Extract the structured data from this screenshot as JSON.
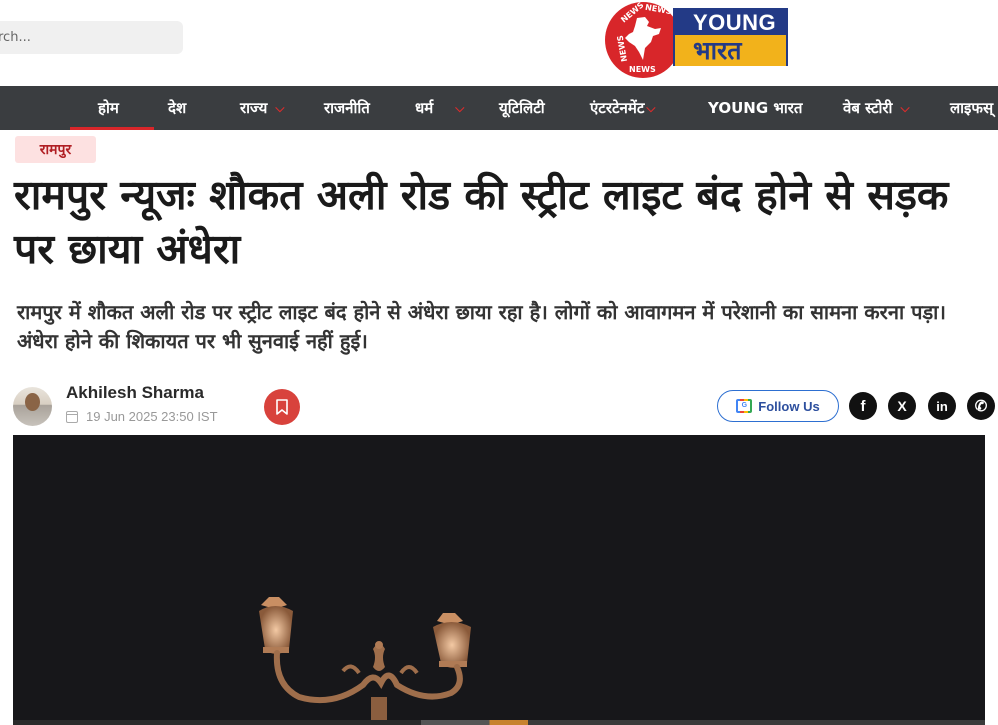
{
  "header": {
    "search_placeholder": "rch...",
    "logo": {
      "young": "YOUNG",
      "bharat": "भारत",
      "ring_text": "NEWS"
    }
  },
  "nav": {
    "items": [
      {
        "label": "होम",
        "has_dropdown": false,
        "active": true
      },
      {
        "label": "देश",
        "has_dropdown": false
      },
      {
        "label": "राज्य",
        "has_dropdown": true
      },
      {
        "label": "राजनीति",
        "has_dropdown": false
      },
      {
        "label": "धर्म",
        "has_dropdown": true
      },
      {
        "label": "यूटिलिटी",
        "has_dropdown": false
      },
      {
        "label": "एंटरटेनमेंट",
        "has_dropdown": true
      },
      {
        "label": "YOUNG भारत",
        "has_dropdown": false
      },
      {
        "label": "वेब स्टोरी",
        "has_dropdown": true
      },
      {
        "label": "लाइफस्",
        "has_dropdown": false
      }
    ]
  },
  "article": {
    "category": "रामपुर",
    "headline": "रामपुर न्यूजः शौकत अली रोड की स्ट्रीट लाइट बंद होने से सड़क पर छाया अंधेरा",
    "summary": "रामपुर में शौकत अली रोड पर स्ट्रीट लाइट बंद होने से अंधेरा छाया रहा है। लोगों को आवागमन में परेशानी का सामना करना पड़ा। अंधेरा होने की शिकायत पर भी सुनवाई नहीं हुई।",
    "author": "Akhilesh Sharma",
    "date": "19 Jun 2025 23:50 IST",
    "follow_label": "Follow Us",
    "follow_icon_text": "G",
    "social": {
      "facebook": "f",
      "x": "X",
      "linkedin": "in",
      "whatsapp": "✆"
    }
  },
  "colors": {
    "brand_red": "#d8262a",
    "nav_bg": "#3a3d40",
    "logo_blue": "#233a86",
    "logo_yellow": "#f2b21b",
    "tag_bg": "#fde1e1",
    "follow_blue": "#2d6fd1"
  }
}
